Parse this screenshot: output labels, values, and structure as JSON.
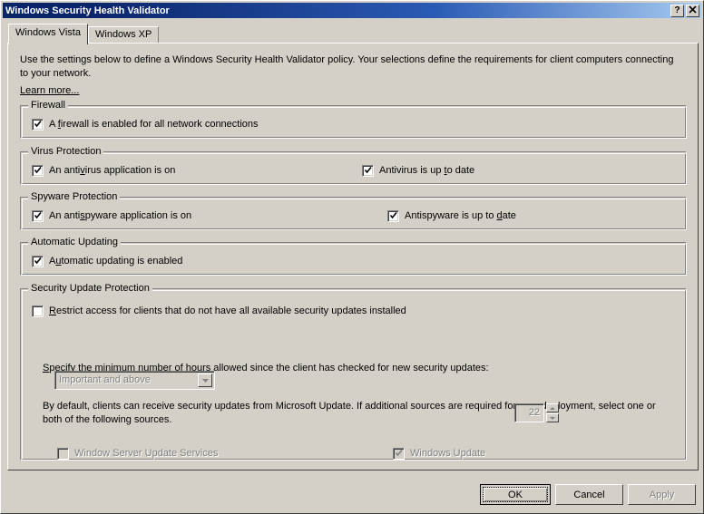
{
  "window": {
    "title": "Windows Security Health Validator",
    "help_button": "?",
    "close_button": "✕"
  },
  "tabs": [
    {
      "label": "Windows Vista",
      "active": true
    },
    {
      "label": "Windows XP",
      "active": false
    }
  ],
  "intro": {
    "text": "Use the settings below to define a Windows Security Health Validator policy. Your selections define the requirements for client computers connecting to your network.",
    "learn_more": "Learn more..."
  },
  "groups": {
    "firewall": {
      "label": "Firewall",
      "checkbox": {
        "pre": "A ",
        "acc": "f",
        "post": "irewall is enabled for all network connections",
        "checked": true,
        "enabled": true
      }
    },
    "virus": {
      "label": "Virus Protection",
      "checkbox_left": {
        "pre": "An anti",
        "acc": "v",
        "post": "irus application is on",
        "checked": true,
        "enabled": true
      },
      "checkbox_right": {
        "pre": "Antivirus is up ",
        "acc": "t",
        "post": "o date",
        "checked": true,
        "enabled": true
      }
    },
    "spyware": {
      "label": "Spyware Protection",
      "checkbox_left": {
        "pre": "An anti",
        "acc": "s",
        "post": "pyware application is on",
        "checked": true,
        "enabled": true
      },
      "checkbox_right": {
        "pre": "Antispyware is up to ",
        "acc": "d",
        "post": "ate",
        "checked": true,
        "enabled": true
      }
    },
    "autoupdate": {
      "label": "Automatic Updating",
      "checkbox": {
        "pre": "A",
        "acc": "u",
        "post": "tomatic updating is enabled",
        "checked": true,
        "enabled": true
      }
    },
    "securityupdate": {
      "label": "Security Update Protection",
      "restrict_checkbox": {
        "pre": "",
        "acc": "R",
        "post": "estrict access for clients that do not have all available security updates installed",
        "checked": false,
        "enabled": true
      },
      "severity_combo": {
        "value": "Important and above",
        "enabled": false
      },
      "hours_label": {
        "pre": "",
        "acc": "S",
        "post": "pecify the minimum number of hours allowed since the client has checked for new security updates:"
      },
      "hours_value": "22",
      "hours_enabled": false,
      "sources_text": "By default, clients can receive security updates from Microsoft Update.  If additional sources are required for your deployment, select one or both of the following sources.",
      "wsus_checkbox": {
        "pre": "Window Server Update Services",
        "acc": "",
        "post": "",
        "checked": false,
        "enabled": false
      },
      "wu_checkbox": {
        "pre": "Windows Update",
        "acc": "",
        "post": "",
        "checked": true,
        "enabled": false
      }
    }
  },
  "buttons": {
    "ok": "OK",
    "cancel": "Cancel",
    "apply": "Apply"
  }
}
